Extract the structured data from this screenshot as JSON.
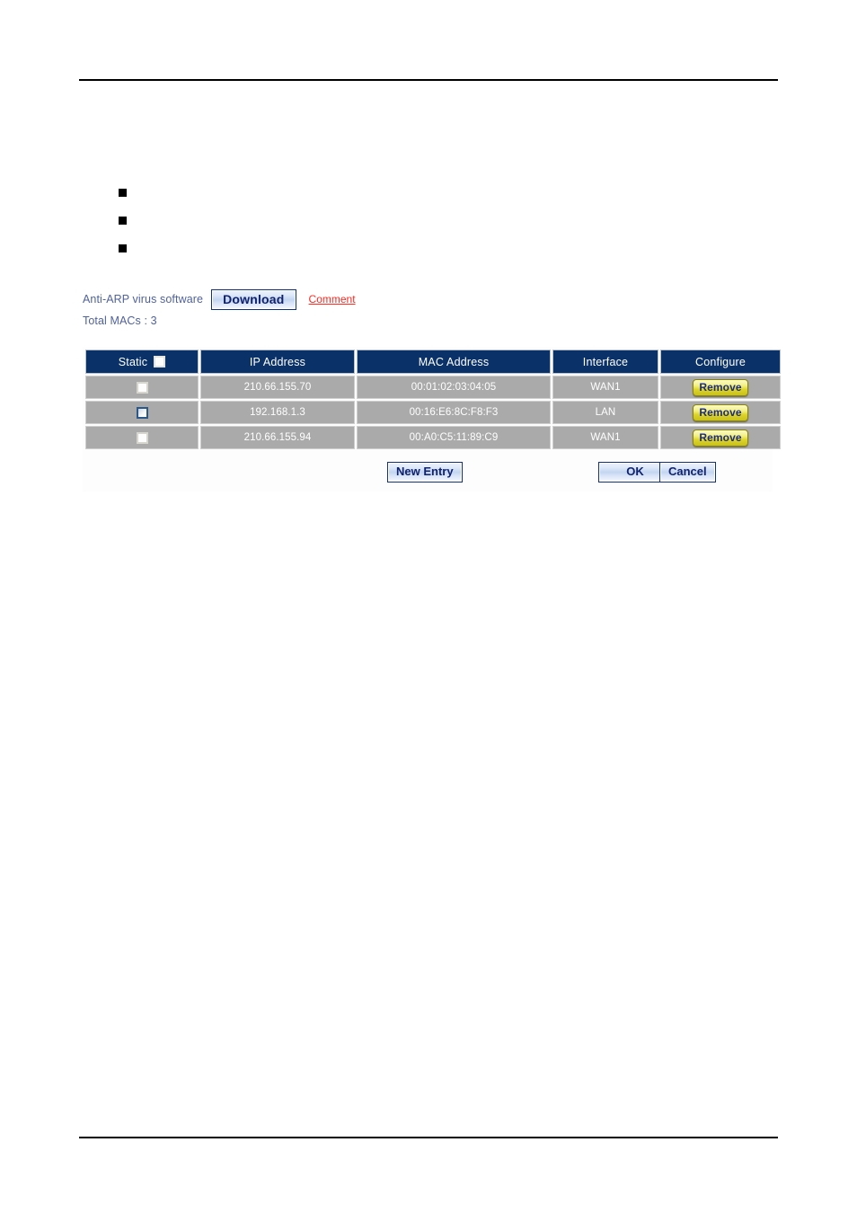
{
  "page": {
    "rules": [
      "top",
      "bottom"
    ]
  },
  "bullets": [
    {
      "marker": "square-bullet",
      "text": ""
    },
    {
      "marker": "square-bullet",
      "text": ""
    },
    {
      "marker": "square-bullet",
      "text": ""
    }
  ],
  "info": {
    "anti_arp_label": "Anti-ARP virus software",
    "download_label": "Download",
    "comment_label": "Comment",
    "total_macs_label": "Total MACs : 3"
  },
  "table": {
    "headers": {
      "static": "Static",
      "ip_address": "IP Address",
      "mac_address": "MAC Address",
      "interface": "Interface",
      "configure": "Configure"
    },
    "header_checkbox_checked": false,
    "rows": [
      {
        "static_checked": false,
        "static_focused": false,
        "ip_address": "210.66.155.70",
        "mac_address": "00:01:02:03:04:05",
        "interface": "WAN1",
        "configure_label": "Remove"
      },
      {
        "static_checked": false,
        "static_focused": true,
        "ip_address": "192.168.1.3",
        "mac_address": "00:16:E6:8C:F8:F3",
        "interface": "LAN",
        "configure_label": "Remove"
      },
      {
        "static_checked": false,
        "static_focused": false,
        "ip_address": "210.66.155.94",
        "mac_address": "00:A0:C5:11:89:C9",
        "interface": "WAN1",
        "configure_label": "Remove"
      }
    ]
  },
  "actions": {
    "new_entry_label": "New  Entry",
    "ok_label": "OK",
    "cancel_label": "Cancel"
  },
  "colors": {
    "header_blue": "#0b3268",
    "row_gray": "#aaaaaa",
    "link_red": "#ff2a22",
    "label_blue": "#50629c",
    "remove_yellow": "#f3f07a",
    "button_blue_text": "#10216e"
  }
}
